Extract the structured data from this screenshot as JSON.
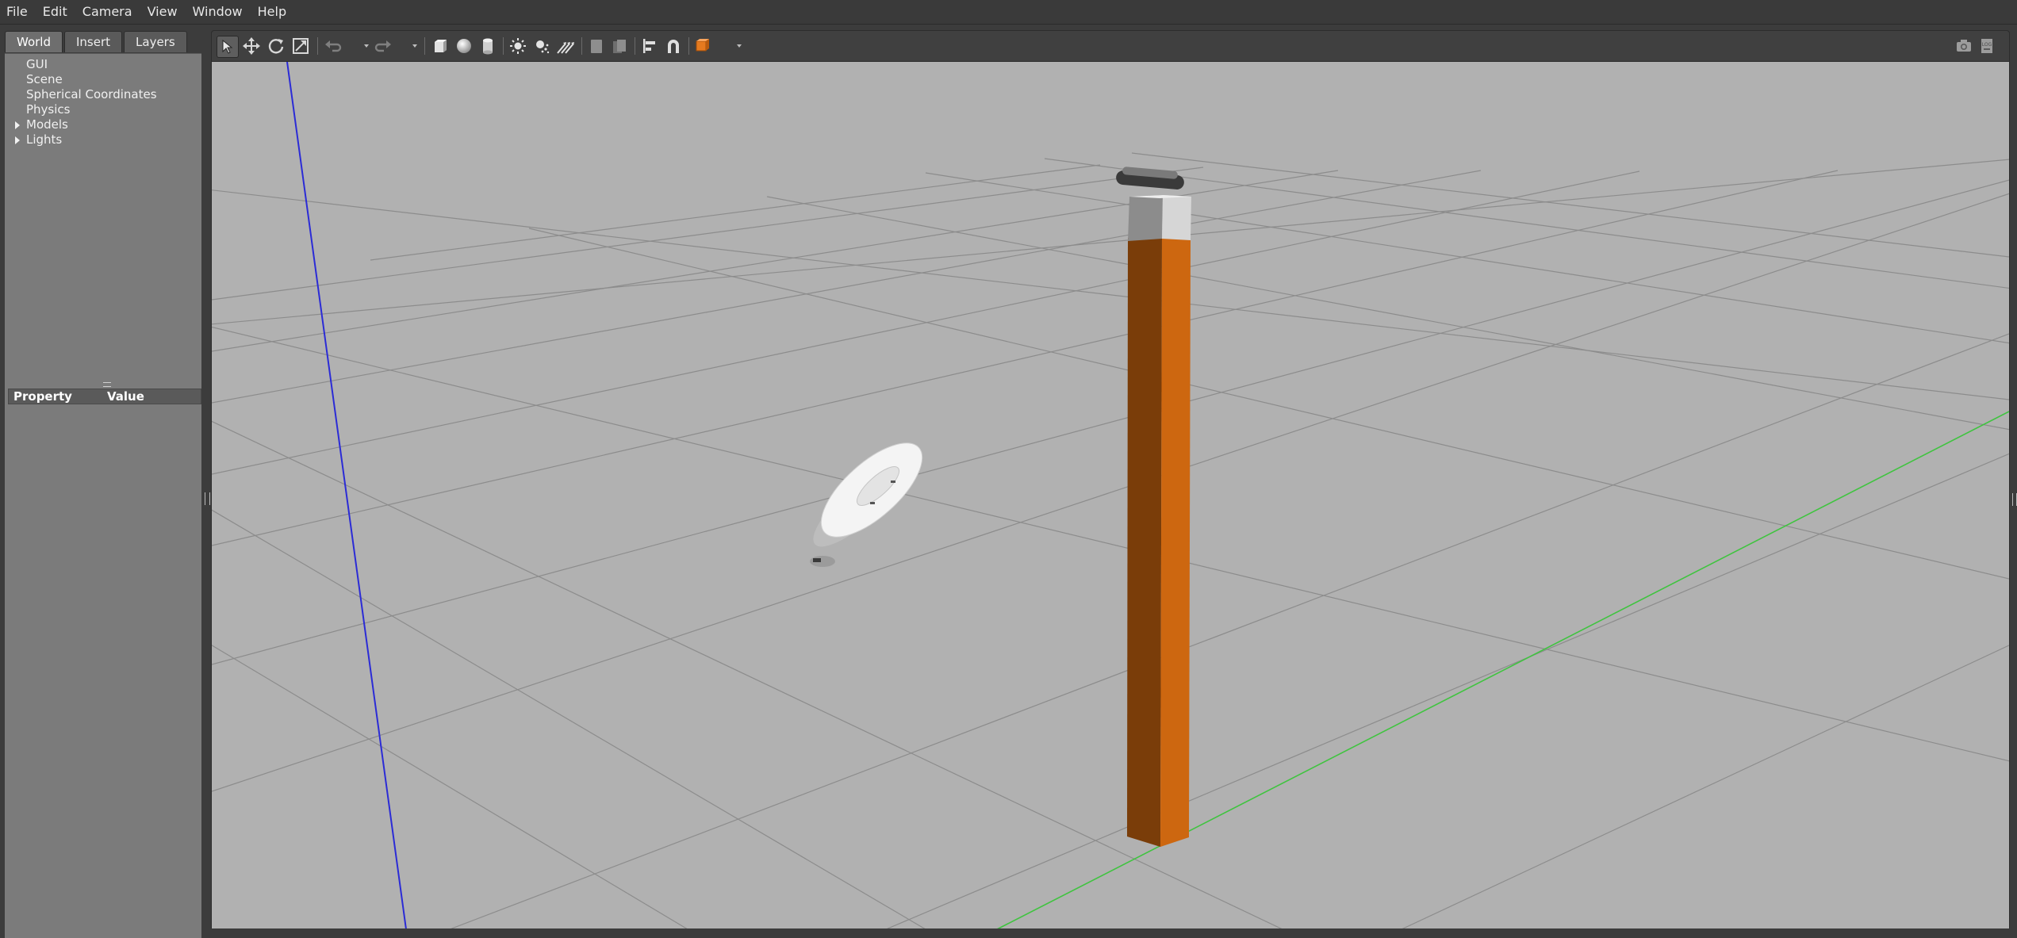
{
  "menubar": {
    "items": [
      "File",
      "Edit",
      "Camera",
      "View",
      "Window",
      "Help"
    ]
  },
  "left_panel": {
    "tabs": [
      {
        "label": "World",
        "active": true
      },
      {
        "label": "Insert",
        "active": false
      },
      {
        "label": "Layers",
        "active": false
      }
    ],
    "tree": [
      {
        "label": "GUI",
        "expandable": false
      },
      {
        "label": "Scene",
        "expandable": false
      },
      {
        "label": "Spherical Coordinates",
        "expandable": false
      },
      {
        "label": "Physics",
        "expandable": false
      },
      {
        "label": "Models",
        "expandable": true
      },
      {
        "label": "Lights",
        "expandable": true
      }
    ],
    "property_table": {
      "headers": [
        "Property",
        "Value"
      ]
    }
  },
  "toolbar": {
    "tools": [
      {
        "name": "select-mode-icon",
        "active": true
      },
      {
        "name": "translate-mode-icon",
        "active": false
      },
      {
        "name": "rotate-mode-icon",
        "active": false
      },
      {
        "name": "scale-mode-icon",
        "active": false
      },
      {
        "name": "undo-icon",
        "active": false
      },
      {
        "name": "redo-icon",
        "active": false
      },
      {
        "name": "box-shape-icon",
        "active": false
      },
      {
        "name": "sphere-shape-icon",
        "active": false
      },
      {
        "name": "cylinder-shape-icon",
        "active": false
      },
      {
        "name": "point-light-icon",
        "active": false
      },
      {
        "name": "spot-light-icon",
        "active": false
      },
      {
        "name": "directional-light-icon",
        "active": false
      },
      {
        "name": "copy-icon",
        "active": false
      },
      {
        "name": "paste-icon",
        "active": false
      },
      {
        "name": "align-icon",
        "active": false
      },
      {
        "name": "snap-icon",
        "active": false
      },
      {
        "name": "view-angle-icon",
        "active": false
      },
      {
        "name": "screenshot-icon",
        "active": false
      },
      {
        "name": "log-icon",
        "active": false
      }
    ]
  },
  "colors": {
    "viewport_bg": "#b1b1b1",
    "grid_line": "#8c8c8c",
    "z_axis": "#2b2bd6",
    "y_axis": "#3fc43f",
    "pillar_front": "#cd6710",
    "pillar_side": "#7a3d09",
    "accent_orange": "#e57a1f"
  }
}
